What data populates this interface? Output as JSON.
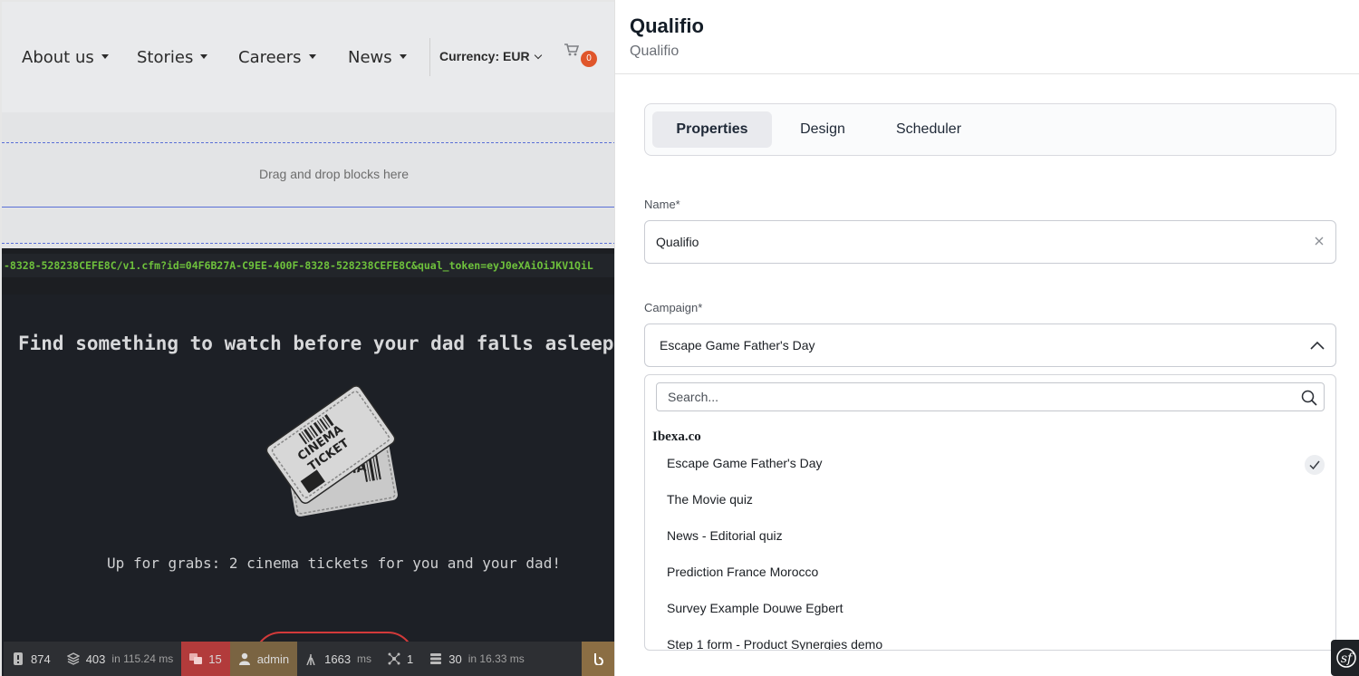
{
  "site": {
    "nav": [
      "About us",
      "Stories",
      "Careers",
      "News"
    ],
    "currency": "Currency: EUR",
    "cart_count": "0",
    "dropzone_text": "Drag and drop blocks here",
    "iframe_url": "-8328-528238CEFE8C/v1.cfm?id=04F6B27A-C9EE-400F-8328-528238CEFE8C&qual_token=eyJ0eXAiOiJKV1QiL",
    "game_title": "Find something to watch before your dad falls asleep",
    "game_subtitle": "Up for grabs: 2 cinema tickets for you and your dad!"
  },
  "debug_toolbar": {
    "status": "874",
    "queries": "403",
    "queries_time": "in 115.24 ms",
    "translations": "15",
    "user": "admin",
    "time": "1663",
    "time_unit": "ms",
    "events": "1",
    "cache": "30",
    "cache_time": "in 16.33 ms"
  },
  "panel": {
    "title": "Qualifio",
    "subtitle": "Qualifio",
    "tabs": [
      "Properties",
      "Design",
      "Scheduler"
    ],
    "active_tab": "Properties",
    "name_label": "Name*",
    "name_value": "Qualifio",
    "campaign_label": "Campaign*",
    "campaign_value": "Escape Game Father's Day",
    "search_placeholder": "Search...",
    "group": "Ibexa.co",
    "options": [
      "Escape Game Father's Day",
      "The Movie quiz",
      "News - Editorial quiz",
      "Prediction France Morocco",
      "Survey Example Douwe Egbert",
      "Step 1 form - Product Synergies demo"
    ],
    "selected_option": "Escape Game Father's Day"
  },
  "colors": {
    "accent_red": "#d33a3a",
    "badge_orange": "#e0562b",
    "url_green": "#6ec13c",
    "dropzone_border": "#5a6fd6"
  }
}
